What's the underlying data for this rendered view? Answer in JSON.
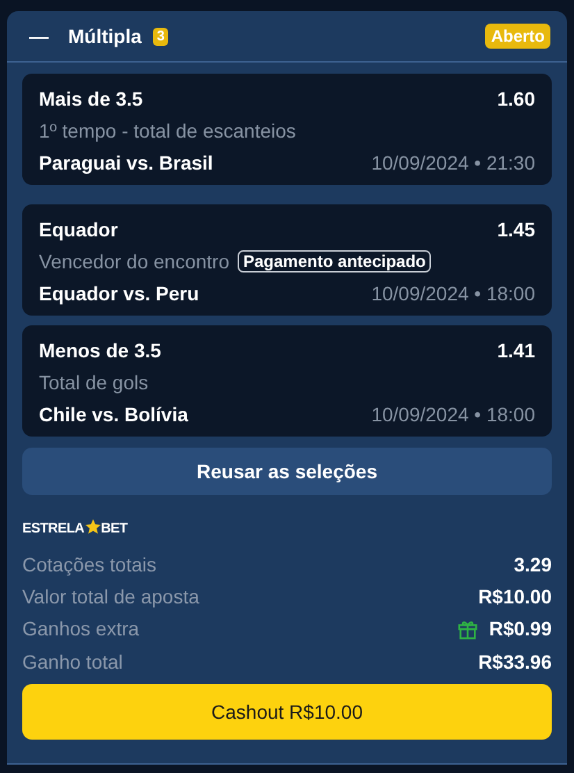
{
  "header": {
    "collapse_icon": "—",
    "title": "Múltipla",
    "count": "3",
    "status": "Aberto"
  },
  "selections": [
    {
      "pick": "Mais de 3.5",
      "odds": "1.60",
      "market": "1º tempo - total de escanteios",
      "match": "Paraguai vs. Brasil",
      "datetime": "10/09/2024 • 21:30"
    },
    {
      "pick": "Equador",
      "odds": "1.45",
      "market": "Vencedor do encontro",
      "tag": "Pagamento antecipado",
      "match": "Equador vs. Peru",
      "datetime": "10/09/2024 • 18:00"
    },
    {
      "pick": "Menos de 3.5",
      "odds": "1.41",
      "market": "Total de gols",
      "match": "Chile vs. Bolívia",
      "datetime": "10/09/2024 • 18:00"
    }
  ],
  "reuse_button": "Reusar as seleções",
  "brand": {
    "left": "ESTRELA",
    "right": "BET"
  },
  "summary": [
    {
      "label": "Cotações totais",
      "value": "3.29",
      "gift": false
    },
    {
      "label": "Valor total de aposta",
      "value": "R$10.00",
      "gift": false
    },
    {
      "label": "Ganhos extra",
      "value": "R$0.99",
      "gift": true
    },
    {
      "label": "Ganho total",
      "value": "R$33.96",
      "gift": false
    }
  ],
  "cashout_button": "Cashout R$10.00"
}
